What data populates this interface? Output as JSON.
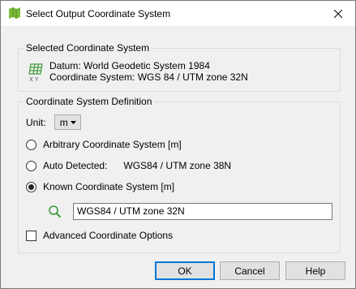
{
  "window": {
    "title": "Select Output Coordinate System",
    "icon": "app-map-icon",
    "close_icon": "close-icon"
  },
  "selected_group": {
    "title": "Selected Coordinate System",
    "datum_line": "Datum: World Geodetic System 1984",
    "cs_line": "Coordinate System: WGS 84 / UTM zone 32N",
    "icon": "coordinate-grid-icon"
  },
  "definition_group": {
    "title": "Coordinate System Definition",
    "unit_label": "Unit:",
    "unit_value": "m",
    "options": [
      {
        "label": "Arbitrary Coordinate System [m]",
        "selected": false
      },
      {
        "label": "Auto Detected:",
        "detected_value": "WGS84 / UTM zone 38N",
        "selected": false
      },
      {
        "label": "Known Coordinate System [m]",
        "selected": true
      }
    ],
    "known_cs_value": "WGS84 / UTM zone 32N",
    "advanced_label": "Advanced Coordinate Options",
    "advanced_checked": false
  },
  "buttons": {
    "ok": "OK",
    "cancel": "Cancel",
    "help": "Help"
  },
  "colors": {
    "accent": "#0078d7",
    "icon_green": "#3e9b3a"
  }
}
